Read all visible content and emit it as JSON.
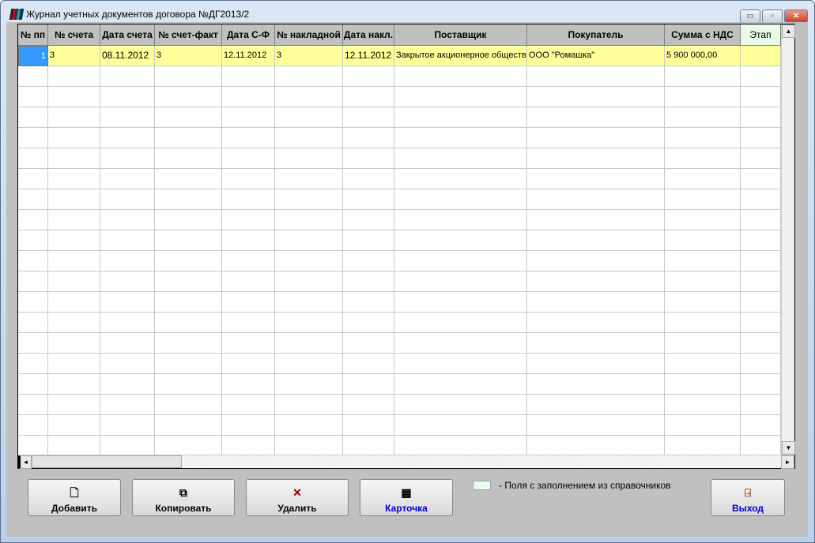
{
  "window": {
    "title": "Журнал учетных документов договора №ДГ2013/2",
    "minimize": "▭",
    "maximize": "▫",
    "close": "✕"
  },
  "columns": [
    {
      "label": "№ пп",
      "w": 38
    },
    {
      "label": "№ счета",
      "w": 66
    },
    {
      "label": "Дата счета",
      "w": 69
    },
    {
      "label": "№ счет-факт",
      "w": 85
    },
    {
      "label": "Дата С-Ф",
      "w": 67
    },
    {
      "label": "№ накладной",
      "w": 86
    },
    {
      "label": "Дата накл.",
      "w": 65
    },
    {
      "label": "Поставщик",
      "w": 168
    },
    {
      "label": "Покупатель",
      "w": 174
    },
    {
      "label": "Сумма с НДС",
      "w": 96
    },
    {
      "label": "Этап",
      "w": 51,
      "light": true
    }
  ],
  "rows": [
    [
      "1",
      "3",
      "08.11.2012",
      "3",
      "12.11.2012",
      "3",
      "12.11.2012",
      "Закрытое акционерное общество",
      "ООО \"Ромашка\"",
      "5 900 000,00",
      ""
    ]
  ],
  "buttons": {
    "add": "Добавить",
    "copy": "Копировать",
    "delete": "Удалить",
    "card": "Карточка",
    "exit": "Выход"
  },
  "legend": "-  Поля с заполнением из справочников",
  "colors": {
    "selected_row": "#ffff99",
    "reference_field": "#e8fbe8",
    "link_blue": "#0000dd"
  }
}
